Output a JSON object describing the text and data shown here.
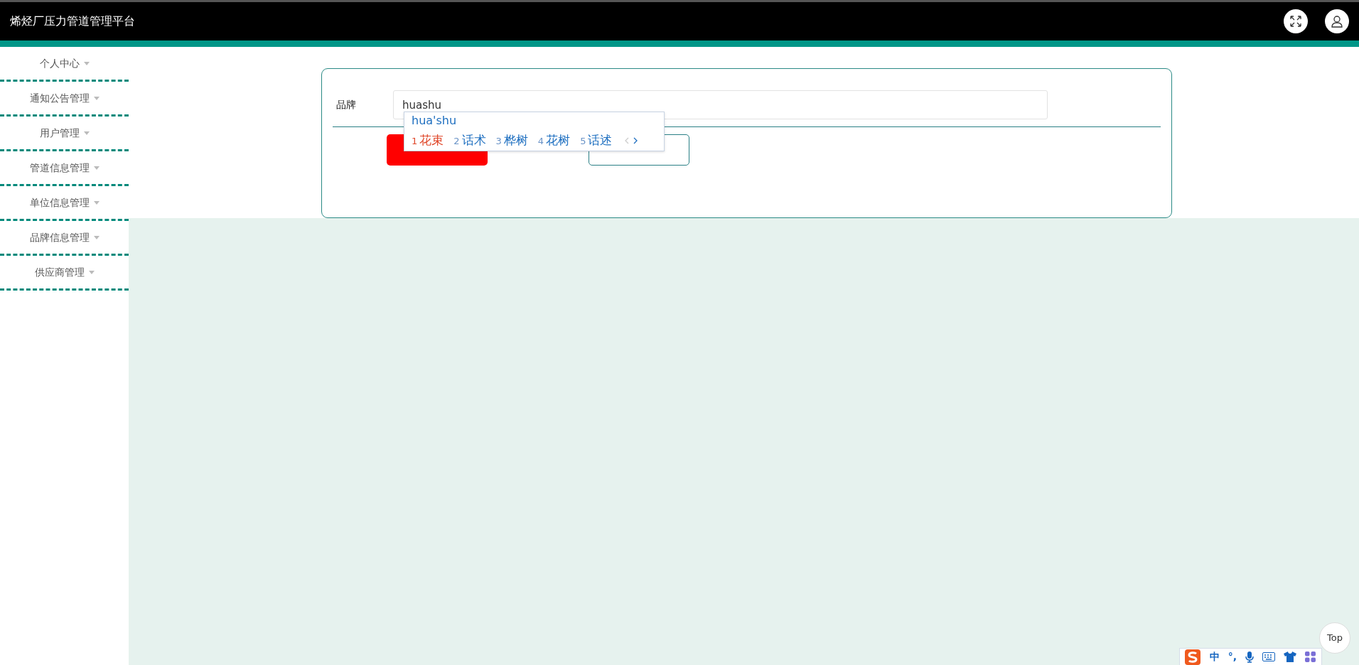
{
  "header": {
    "title": "烯烃厂压力管道管理平台"
  },
  "sidebar": {
    "items": [
      {
        "label": "个人中心"
      },
      {
        "label": "通知公告管理"
      },
      {
        "label": "用户管理"
      },
      {
        "label": "管道信息管理"
      },
      {
        "label": "单位信息管理"
      },
      {
        "label": "品牌信息管理"
      },
      {
        "label": "供应商管理"
      }
    ]
  },
  "form": {
    "field": {
      "label": "品牌",
      "value": "huashu"
    },
    "buttons": [
      {
        "kind": "submit"
      },
      {
        "kind": "cancel"
      }
    ]
  },
  "ime_popup": {
    "composition": "hua'shu",
    "candidates": [
      {
        "index": "1",
        "text": "花束",
        "selected": true
      },
      {
        "index": "2",
        "text": "话术",
        "selected": false
      },
      {
        "index": "3",
        "text": "桦树",
        "selected": false
      },
      {
        "index": "4",
        "text": "花树",
        "selected": false
      },
      {
        "index": "5",
        "text": "话述",
        "selected": false
      }
    ]
  },
  "back_to_top": {
    "label": "Top"
  },
  "ime_toolbar": {
    "mode": "中",
    "punctuation": "°,"
  }
}
